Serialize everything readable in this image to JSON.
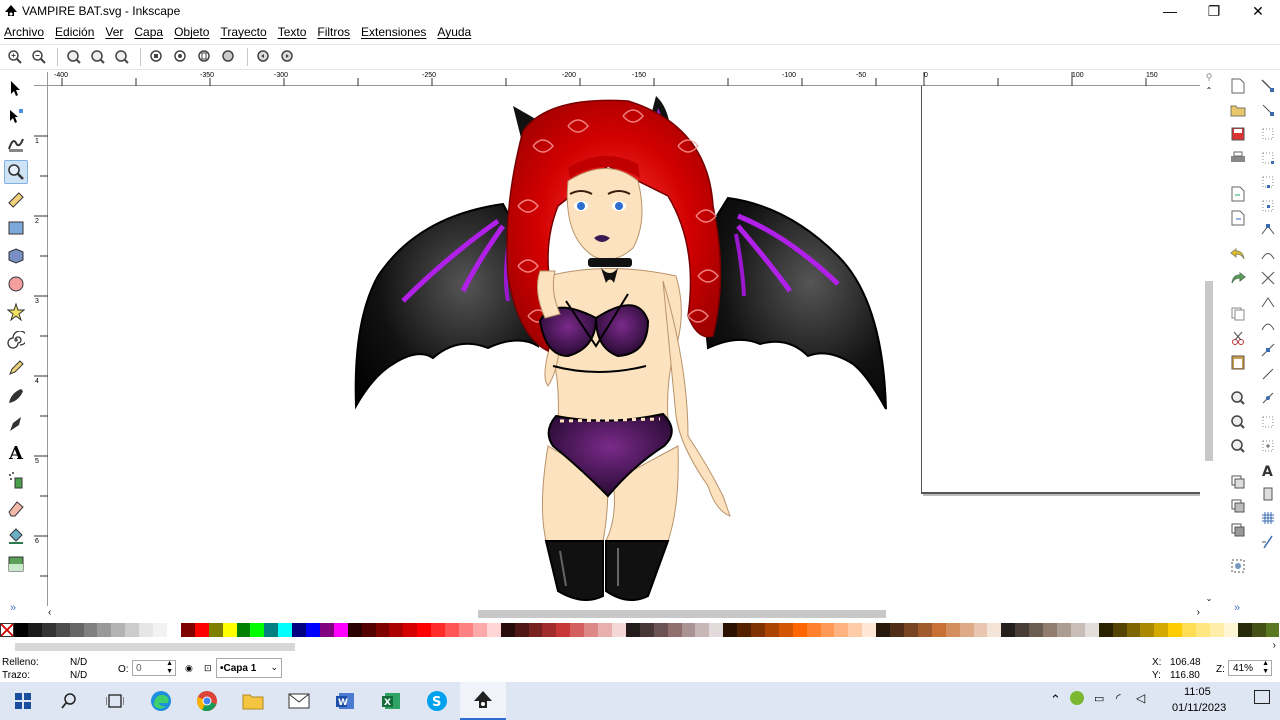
{
  "window": {
    "title": "VAMPIRE BAT.svg - Inkscape",
    "controls": {
      "minimize": "—",
      "maximize": "❐",
      "close": "✕"
    }
  },
  "menu": {
    "items": [
      "Archivo",
      "Edición",
      "Ver",
      "Capa",
      "Objeto",
      "Trayecto",
      "Texto",
      "Filtros",
      "Extensiones",
      "Ayuda"
    ]
  },
  "zoom_toolbar": {
    "icons": [
      "zoom-in-icon",
      "zoom-out-icon",
      "zoom-1-1-icon",
      "zoom-1-2-icon",
      "zoom-2-1-icon",
      "zoom-selection-icon",
      "zoom-drawing-icon",
      "zoom-page-icon",
      "zoom-page-width-icon",
      "zoom-prev-icon",
      "zoom-next-icon"
    ]
  },
  "toolbox": {
    "tools": [
      "selector-tool-icon",
      "node-tool-icon",
      "tweak-tool-icon",
      "zoom-tool-icon",
      "measure-tool-icon",
      "rectangle-tool-icon",
      "box-3d-tool-icon",
      "ellipse-tool-icon",
      "star-tool-icon",
      "spiral-tool-icon",
      "pencil-tool-icon",
      "pen-tool-icon",
      "calligraphy-tool-icon",
      "text-tool-icon",
      "spray-tool-icon",
      "eraser-tool-icon",
      "paint-bucket-tool-icon",
      "gradient-tool-icon"
    ],
    "active": "zoom-tool-icon"
  },
  "ruler": {
    "labels": [
      "-400",
      "-350",
      "-300",
      "-250",
      "-200",
      "-150",
      "-100",
      "-50",
      "0",
      "50",
      "100",
      "150"
    ],
    "vlabels": [
      "-1",
      "1",
      "2",
      "3",
      "4",
      "5",
      "6",
      "7"
    ]
  },
  "canvas": {
    "drawing": "vampire-bat-girl-illustration"
  },
  "commands_bar": {
    "icons": [
      "new-document-icon",
      "open-document-icon",
      "save-document-icon",
      "print-icon",
      "import-icon",
      "export-icon",
      "undo-icon",
      "redo-icon",
      "copy-icon",
      "cut-icon",
      "paste-icon",
      "zoom-selection-icon",
      "zoom-drawing-icon",
      "zoom-page-icon",
      "duplicate-icon",
      "clone-icon",
      "unlink-clone-icon",
      "group-icon"
    ]
  },
  "snap_bar": {
    "icons": [
      "snap-enable-icon",
      "snap-bbox-icon",
      "snap-bbox-edge-icon",
      "snap-bbox-corner-icon",
      "snap-bbox-midpoint-icon",
      "snap-bbox-center-icon",
      "snap-nodes-icon",
      "snap-path-icon",
      "snap-intersection-icon",
      "snap-cusp-icon",
      "snap-smooth-icon",
      "snap-midpoint-icon",
      "snap-object-center-icon",
      "snap-rotation-center-icon",
      "snap-text-baseline-icon",
      "snap-page-border-icon",
      "snap-grid-icon",
      "snap-guide-icon"
    ]
  },
  "palette": {
    "colors": [
      "#000000",
      "#1a1a1a",
      "#333333",
      "#4d4d4d",
      "#666666",
      "#808080",
      "#999999",
      "#b3b3b3",
      "#cccccc",
      "#e6e6e6",
      "#f2f2f2",
      "#ffffff",
      "#800000",
      "#ff0000",
      "#808000",
      "#ffff00",
      "#008000",
      "#00ff00",
      "#008080",
      "#00ffff",
      "#000080",
      "#0000ff",
      "#800080",
      "#ff00ff",
      "#2b0000",
      "#550000",
      "#800000",
      "#aa0000",
      "#d40000",
      "#ff0000",
      "#ff2a2a",
      "#ff5555",
      "#ff8080",
      "#ffaaaa",
      "#ffd5d5",
      "#280b0b",
      "#501616",
      "#782121",
      "#a02c2c",
      "#c83737",
      "#d35f5f",
      "#de8787",
      "#e9afaf",
      "#f4d7d7",
      "#241c1c",
      "#483737",
      "#6c5353",
      "#916f6f",
      "#ac9393",
      "#c8b7b7",
      "#e3dbdb",
      "#2b1100",
      "#552200",
      "#803300",
      "#aa4400",
      "#d45500",
      "#ff6600",
      "#ff7f2a",
      "#ff9955",
      "#ffb380",
      "#ffccaa",
      "#ffe6d5",
      "#28170b",
      "#502d16",
      "#784421",
      "#a05a2c",
      "#c87137",
      "#d38d5f",
      "#deaa87",
      "#e9c6af",
      "#f4e3d7",
      "#241f1c",
      "#483e37",
      "#6c5d53",
      "#917c6f",
      "#ac9d93",
      "#c8beb7",
      "#e3dedb",
      "#2b2200",
      "#554400",
      "#806600",
      "#aa8800",
      "#d4aa00",
      "#ffcc00",
      "#ffdd55",
      "#ffe680",
      "#ffeeaa",
      "#fff6d5",
      "#282b0b",
      "#445016",
      "#5a7821"
    ]
  },
  "status": {
    "fill_label": "Relleno:",
    "fill_value": "N/D",
    "stroke_label": "Trazo:",
    "stroke_value": "N/D",
    "opacity_label": "O:",
    "opacity_value": "0",
    "layer_name": "•Capa 1",
    "x_label": "X:",
    "x_value": "106.48",
    "y_label": "Y:",
    "y_value": "116.80",
    "zoom_label": "Z:",
    "zoom_value": "41%"
  },
  "taskbar": {
    "apps": [
      "windows-start-icon",
      "search-icon",
      "task-view-icon",
      "edge-icon",
      "chrome-icon",
      "file-explorer-icon",
      "mail-icon",
      "word-icon",
      "excel-icon",
      "skype-icon",
      "inkscape-icon"
    ],
    "active_app": "inkscape-icon",
    "time": "11:05",
    "date": "01/11/2023",
    "tray": [
      "chevron-up-icon",
      "shield-update-icon",
      "battery-icon",
      "wifi-icon",
      "volume-icon"
    ]
  }
}
